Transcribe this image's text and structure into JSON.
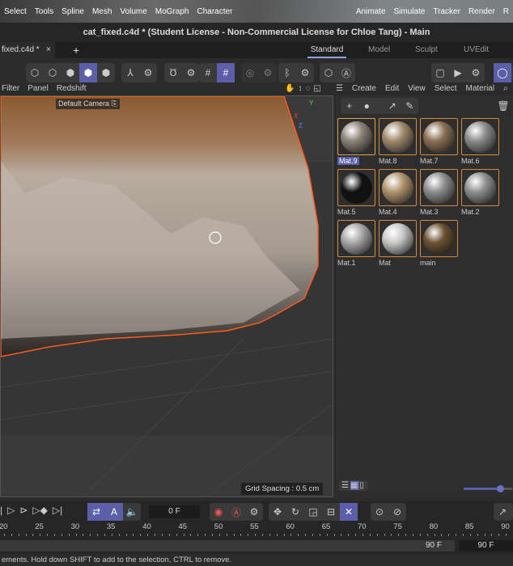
{
  "menubar": {
    "items": [
      "Select",
      "Tools",
      "Spline",
      "Mesh",
      "Volume",
      "MoGraph",
      "Character"
    ],
    "right_items": [
      "Animate",
      "Simulate",
      "Tracker",
      "Render",
      "R"
    ]
  },
  "window": {
    "title": "cat_fixed.c4d * (Student License - Non-Commercial License for Chloe Tang) - Main"
  },
  "tabs": {
    "document": "fixed.c4d *",
    "close": "×",
    "add": "+",
    "layouts": [
      "Standard",
      "Model",
      "Sculpt",
      "UVEdit"
    ],
    "active_layout": "Standard"
  },
  "viewport": {
    "menu": [
      "Filter",
      "Panel",
      "Redshift"
    ],
    "camera": "Default Camera",
    "grid_spacing": "Grid Spacing : 0.5 cm",
    "axes": {
      "x": "X",
      "y": "Y",
      "z": "Z"
    }
  },
  "materials": {
    "menu": [
      "Create",
      "Edit",
      "View",
      "Select",
      "Material"
    ],
    "items": [
      {
        "name": "Mat.9",
        "color": "#8a8478",
        "selected": true
      },
      {
        "name": "Mat.8",
        "color": "#a08a6e"
      },
      {
        "name": "Mat.7",
        "color": "#8a7055"
      },
      {
        "name": "Mat.6",
        "color": "#8c8c8c"
      },
      {
        "name": "Mat.5",
        "color": "#111111"
      },
      {
        "name": "Mat.4",
        "color": "#b0946e"
      },
      {
        "name": "Mat.3",
        "color": "#8e8e8e"
      },
      {
        "name": "Mat.2",
        "color": "#909090"
      },
      {
        "name": "Mat.1",
        "color": "#a8a8a8"
      },
      {
        "name": "Mat",
        "color": "#c8c8c8"
      },
      {
        "name": "main",
        "color": "#6a5030"
      }
    ],
    "zoom_level": 0.75
  },
  "timeline": {
    "current_frame": "0 F",
    "ruler": [
      "20",
      "25",
      "30",
      "35",
      "40",
      "45",
      "50",
      "55",
      "60",
      "65",
      "70",
      "75",
      "80",
      "85",
      "90"
    ],
    "end_frame": "90 F",
    "max_frame": "90 F"
  },
  "status": {
    "text": "ements. Hold down SHIFT to add to the selection, CTRL to remove."
  },
  "colors": {
    "accent": "#5a5fa8",
    "material_border": "#d88a3a",
    "selection_outline": "#ff5a1f"
  }
}
